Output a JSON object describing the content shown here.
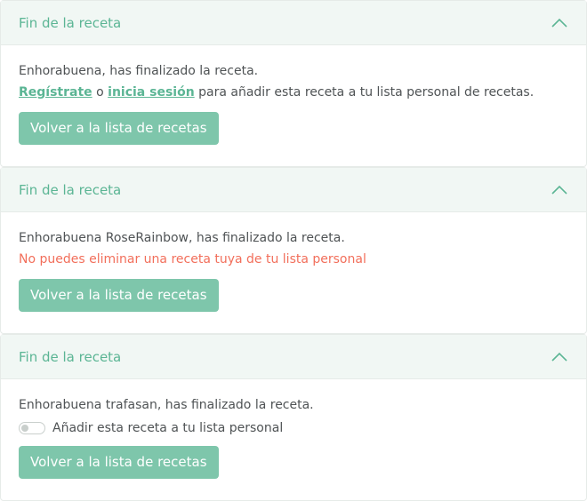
{
  "cards": [
    {
      "title": "Fin de la receta",
      "message": "Enhorabuena, has finalizado la receta.",
      "register_link": "Regístrate",
      "connector": " o ",
      "login_link": "inicia sesión",
      "login_suffix": " para añadir esta receta a tu lista personal de recetas.",
      "button": "Volver a la lista de recetas"
    },
    {
      "title": "Fin de la receta",
      "message": "Enhorabuena RoseRainbow, has finalizado la receta.",
      "error": "No puedes eliminar una receta tuya de tu lista personal",
      "button": "Volver a la lista de recetas"
    },
    {
      "title": "Fin de la receta",
      "message": "Enhorabuena trafasan, has finalizado la receta.",
      "toggle_label": "Añadir esta receta a tu lista personal",
      "toggle_on": false,
      "button": "Volver a la lista de recetas"
    }
  ],
  "colors": {
    "accent": "#5bb594",
    "button": "#7ec6ab",
    "header_bg": "#f1f7f4",
    "error": "#f26f5b"
  },
  "icons": {
    "collapse": "chevron-up-icon"
  }
}
